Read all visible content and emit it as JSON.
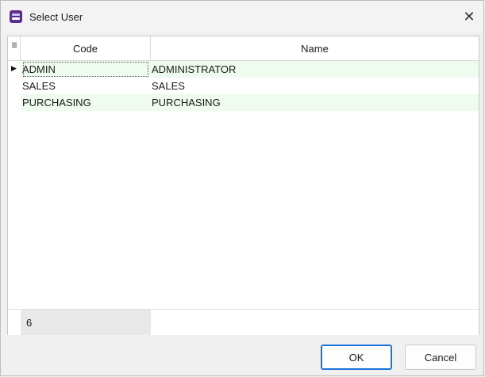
{
  "window": {
    "title": "Select User",
    "close_glyph": "✕",
    "app_icon": "app-icon"
  },
  "grid": {
    "columns": [
      "Code",
      "Name"
    ],
    "indicator_icon": "column-chooser-icon",
    "indicator_glyph": "≣",
    "current_row_glyph": "▶",
    "rows": [
      {
        "code": "ADMIN",
        "name": "ADMINISTRATOR"
      },
      {
        "code": "SALES",
        "name": "SALES"
      },
      {
        "code": "PURCHASING",
        "name": "PURCHASING"
      }
    ],
    "footer_count": "6",
    "alt_row_color": "#eefbee"
  },
  "buttons": {
    "ok": "OK",
    "cancel": "Cancel"
  }
}
